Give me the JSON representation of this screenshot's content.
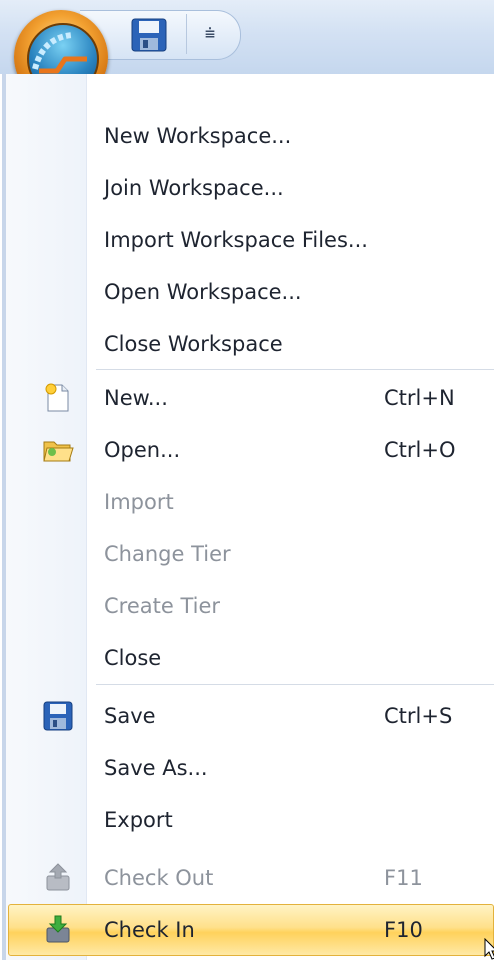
{
  "colors": {
    "highlight": "#ffe08a",
    "disabled_text": "#8d939c",
    "text": "#1e2430"
  },
  "toolbar": {
    "app_button_icon": "office-orb-icon",
    "save_icon": "save-icon",
    "customize_icon": "customize-toolbar-icon",
    "customize_glyph": "⩧"
  },
  "menu": {
    "workspace_items": [
      {
        "label": "New Workspace...",
        "mnemonic": "e"
      },
      {
        "label": "Join Workspace...",
        "mnemonic": "J"
      },
      {
        "label": "Import Workspace Files...",
        "mnemonic": "p"
      },
      {
        "label": "Open Workspace...",
        "mnemonic": "W"
      },
      {
        "label": "Close Workspace",
        "mnemonic": "k"
      }
    ],
    "file_items": [
      {
        "label": "New...",
        "shortcut": "Ctrl+N",
        "icon": "new-document-icon",
        "enabled": true
      },
      {
        "label": "Open...",
        "shortcut": "Ctrl+O",
        "icon": "open-folder-icon",
        "enabled": true
      },
      {
        "label": "Import",
        "shortcut": "",
        "enabled": false
      },
      {
        "label": "Change Tier",
        "shortcut": "",
        "enabled": false
      },
      {
        "label": "Create Tier",
        "shortcut": "",
        "enabled": false
      },
      {
        "label": "Close",
        "shortcut": "",
        "enabled": true
      }
    ],
    "save_items": [
      {
        "label": "Save",
        "shortcut": "Ctrl+S",
        "icon": "save-icon",
        "enabled": true
      },
      {
        "label": "Save As...",
        "shortcut": "",
        "enabled": true
      },
      {
        "label": "Export",
        "shortcut": "",
        "enabled": true
      },
      {
        "label": "Check Out",
        "shortcut": "F11",
        "icon": "check-out-icon",
        "enabled": false
      },
      {
        "label": "Check In",
        "shortcut": "F10",
        "icon": "check-in-icon",
        "enabled": true,
        "highlighted": true
      }
    ]
  }
}
